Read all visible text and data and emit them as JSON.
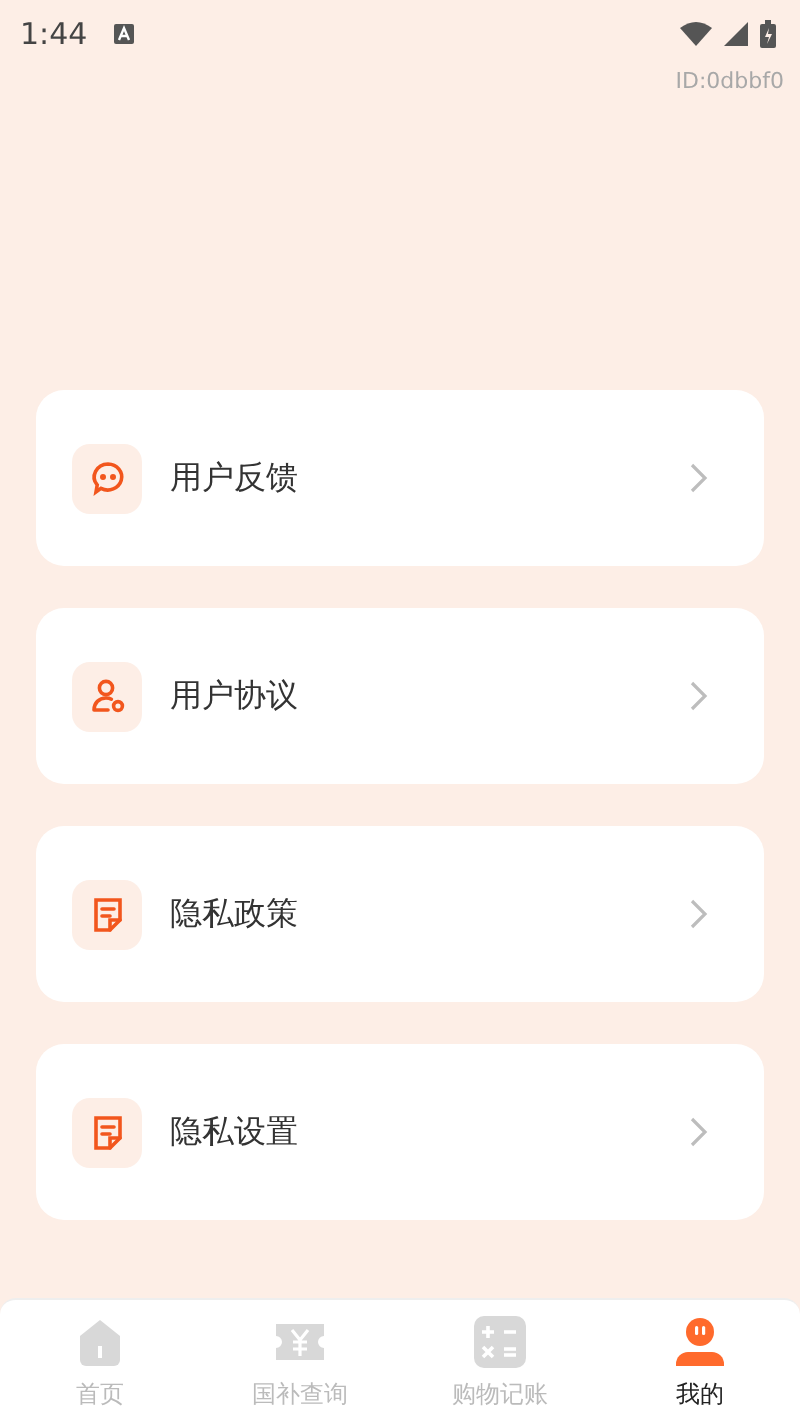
{
  "status_bar": {
    "time": "1:44"
  },
  "device_id": "ID:0dbbf0",
  "menu": [
    {
      "label": "用户反馈",
      "kind": "chat"
    },
    {
      "label": "用户协议",
      "kind": "user"
    },
    {
      "label": "隐私政策",
      "kind": "doc"
    },
    {
      "label": "隐私设置",
      "kind": "doc"
    }
  ],
  "tab_bar": [
    {
      "label": "首页",
      "kind": "home",
      "selected": false
    },
    {
      "label": "国补查询",
      "kind": "ticket",
      "selected": false
    },
    {
      "label": "购物记账",
      "kind": "calc",
      "selected": false
    },
    {
      "label": "我的",
      "kind": "person",
      "selected": true
    }
  ]
}
